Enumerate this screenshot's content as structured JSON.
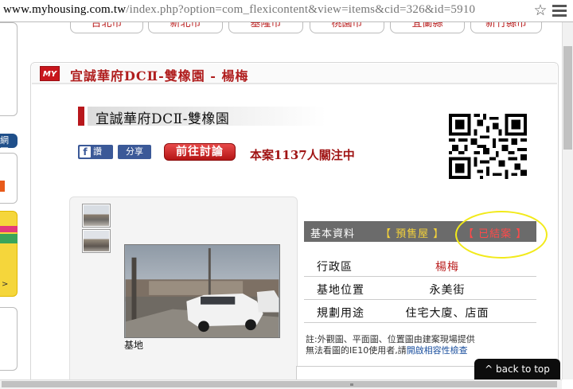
{
  "browser": {
    "url_main": "www.myhousing.com.tw",
    "url_rest": "/index.php?option=com_flexicontent&view=items&cid=326&id=5910"
  },
  "sidebar": {
    "tab_text": "網圖",
    "teaser": ">"
  },
  "city_tabs": [
    "台北市",
    "新北市",
    "基隆市",
    "桃園市",
    "宜蘭縣",
    "新竹縣市"
  ],
  "header": {
    "logo": "MY",
    "title": "宜誠華府DCⅡ-雙橡園 - 楊梅"
  },
  "project": {
    "title": "宜誠華府DCⅡ-雙橡園",
    "fb_like": "讚",
    "fb_share": "分享",
    "discuss_button": "前往討論",
    "attention": "本案1137人關注中"
  },
  "gallery": {
    "caption": "基地"
  },
  "info": {
    "header_label": "基本資料",
    "presale": "【 預售屋 】",
    "soldout": "【 已結案 】",
    "rows": [
      {
        "label": "行政區",
        "value": "楊梅"
      },
      {
        "label": "基地位置",
        "value": "永美街"
      },
      {
        "label": "規劃用途",
        "value": "住宅大廈、店面"
      }
    ],
    "note": "註:外觀圖、平面圖、位置圖由建案現場提供",
    "note2": "無法看圖的IE10使用者,請",
    "note_link": "開啟相容性檢查"
  },
  "back_to_top": "^ back to top",
  "colors": {
    "brand_red": "#c8161d",
    "facebook_blue": "#3b5998",
    "presale_yellow": "#f4d23a",
    "soldout_red": "#ff4a4a",
    "highlight_circle": "#f2ea1a"
  }
}
